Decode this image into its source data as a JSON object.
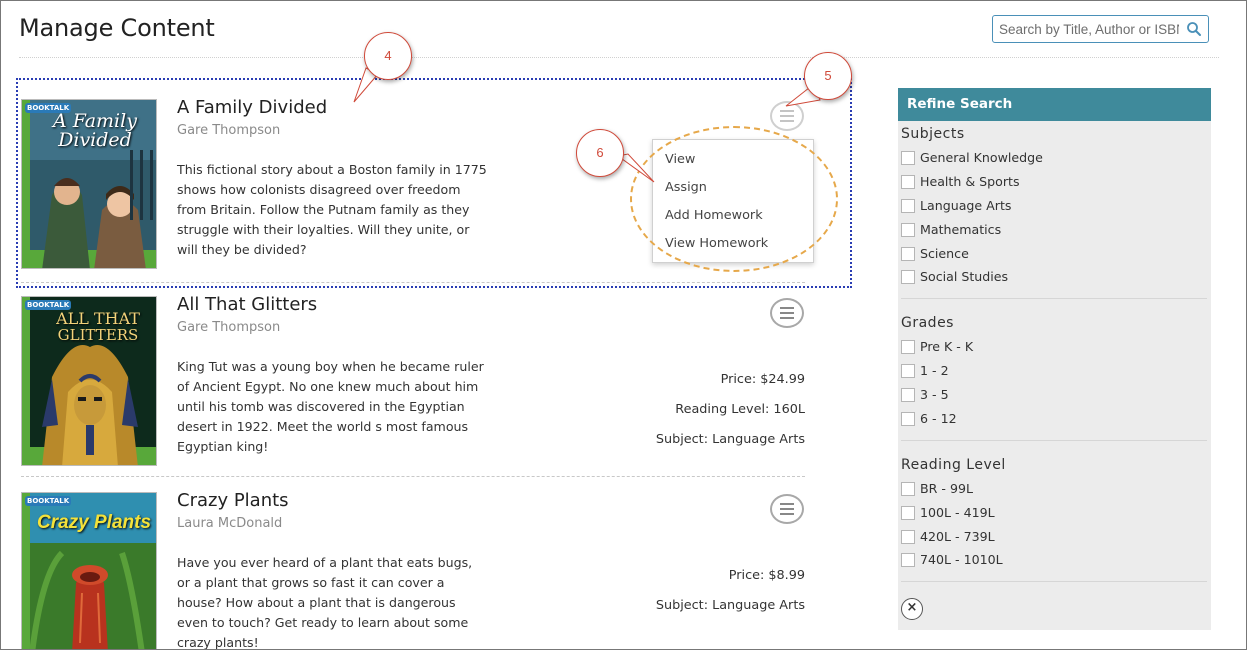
{
  "page": {
    "title": "Manage Content"
  },
  "search": {
    "placeholder": "Search by Title, Author or ISBN"
  },
  "books": [
    {
      "title": "A Family Divided",
      "author": "Gare Thompson",
      "description": "This fictional story about a Boston family in 1775 shows how colonists disagreed over freedom from Britain. Follow the Putnam family as they struggle with their loyalties. Will they unite, or will they be divided?",
      "cover_series": "BOOKTALK",
      "cover_title": "A Family Divided"
    },
    {
      "title": "All That Glitters",
      "author": "Gare Thompson",
      "description": "King Tut was a young boy when he became ruler of Ancient Egypt. No one knew much about him until his tomb was discovered in the Egyptian desert in 1922. Meet the world s most famous Egyptian king!",
      "price": "Price: $24.99",
      "reading_level": "Reading Level: 160L",
      "subject": "Subject: Language Arts",
      "cover_series": "BOOKTALK",
      "cover_title_line1": "ALL THAT",
      "cover_title_line2": "GLITTERS"
    },
    {
      "title": "Crazy Plants",
      "author": "Laura McDonald",
      "description": "Have you ever heard of a plant that eats bugs, or a plant that grows so fast it can cover a house? How about a plant that is dangerous even to touch? Get ready to learn about some crazy plants!",
      "price": "Price: $8.99",
      "subject": "Subject: Language Arts",
      "cover_series": "BOOKTALK",
      "cover_title": "Crazy Plants"
    }
  ],
  "dropdown_menu": [
    "View",
    "Assign",
    "Add Homework",
    "View Homework"
  ],
  "callouts": [
    "4",
    "5",
    "6"
  ],
  "refine": {
    "header": "Refine Search",
    "subjects_title": "Subjects",
    "subjects": [
      "General Knowledge",
      "Health & Sports",
      "Language Arts",
      "Mathematics",
      "Science",
      "Social Studies"
    ],
    "grades_title": "Grades",
    "grades": [
      "Pre K - K",
      "1 - 2",
      "3 - 5",
      "6 - 12"
    ],
    "reading_title": "Reading Level",
    "reading_levels": [
      "BR - 99L",
      "100L - 419L",
      "420L - 739L",
      "740L - 1010L"
    ],
    "clear_symbol": "×"
  },
  "colors": {
    "refine_header": "#3f8a9b",
    "highlight_border": "#2a3db3",
    "callout_ring": "#e6a84a",
    "callout_text": "#d04a3a"
  },
  "icons": [
    "search-icon",
    "hamburger-menu-icon",
    "close-icon"
  ]
}
